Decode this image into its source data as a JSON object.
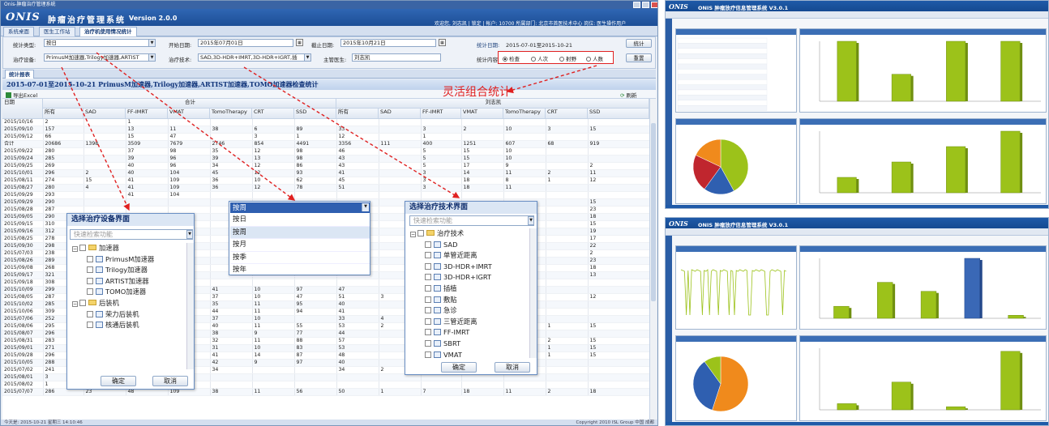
{
  "window": {
    "title": "Onis-肿瘤治疗管理系统"
  },
  "app": {
    "logo": "ONIS",
    "name": "肿瘤治疗管理系统",
    "version": "Version 2.0.0"
  },
  "user_bar": {
    "text": "欢迎您, 刘志凯 | 锁定 | 帐户: 10700 所属部门: 北京市首医技术中心 岗位: 医生操作用户"
  },
  "tabs": [
    {
      "label": "系统桌面"
    },
    {
      "label": "医生工作站"
    },
    {
      "label": "治疗机使用情况统计"
    }
  ],
  "filters": {
    "stat_type_label": "统计类型:",
    "stat_type_value": "按日",
    "start_label": "开始日期:",
    "start_value": "2015年07月01日",
    "end_label": "截止日期:",
    "end_value": "2015年10月21日",
    "stat_date_label": "统计日期:",
    "stat_date_value": "2015-07-01至2015-10-21",
    "device_label": "治疗设备:",
    "device_value": "PrimusM加速器,Trilogy加速器,ARTIST",
    "tech_label": "治疗技术:",
    "tech_value": "SAD,3D-HDR+IMRT,3D-HDR+IGRT,插",
    "doctor_label": "主管医生:",
    "doctor_value": "刘志凯",
    "content_label": "统计内容:",
    "radios": [
      {
        "label": "检查",
        "checked": true
      },
      {
        "label": "人次",
        "checked": false
      },
      {
        "label": "射野",
        "checked": false
      },
      {
        "label": "人数",
        "checked": false
      }
    ],
    "stat_button": "统计",
    "reset_button": "重置"
  },
  "report": {
    "tab": "统计报表",
    "title": "2015-07-01至2015-10-21 PrimusM加速器,Trilogy加速器,ARTIST加速器,TOMO加速器检查统计",
    "export": "导出Excel",
    "refresh": "刷新",
    "group1": "合计",
    "group2": "刘志凯",
    "date_col": "日期",
    "columns1": [
      "所有",
      "SAD",
      "FF-IMRT",
      "VMAT",
      "TomoTherapy",
      "CRT",
      "SSD"
    ],
    "columns2": [
      "所有",
      "SAD",
      "FF-IMRT",
      "VMAT",
      "TomoTherapy",
      "CRT",
      "SSD"
    ],
    "rows": [
      [
        "2015/10/16",
        "2",
        "",
        "1",
        "",
        "",
        "",
        "",
        "",
        "",
        "",
        "",
        "",
        "",
        ""
      ],
      [
        "2015/09/10",
        "157",
        "",
        "13",
        "11",
        "38",
        "6",
        "89",
        "33",
        "",
        "3",
        "2",
        "10",
        "3",
        "15"
      ],
      [
        "2015/09/12",
        "66",
        "",
        "15",
        "47",
        "",
        "3",
        "1",
        "12",
        "",
        "1",
        "",
        "",
        "",
        ""
      ],
      [
        "合计",
        "20686",
        "1398",
        "3509",
        "7679",
        "2746",
        "854",
        "4491",
        "3356",
        "111",
        "400",
        "1251",
        "607",
        "68",
        "919"
      ],
      [
        "2015/09/22",
        "280",
        "",
        "37",
        "98",
        "35",
        "12",
        "98",
        "46",
        "",
        "5",
        "15",
        "10",
        "",
        ""
      ],
      [
        "2015/09/24",
        "285",
        "",
        "39",
        "96",
        "39",
        "13",
        "98",
        "43",
        "",
        "5",
        "15",
        "10",
        "",
        ""
      ],
      [
        "2015/09/25",
        "269",
        "",
        "40",
        "96",
        "34",
        "12",
        "86",
        "43",
        "",
        "5",
        "17",
        "9",
        "",
        "2"
      ],
      [
        "2015/10/01",
        "296",
        "2",
        "40",
        "104",
        "45",
        "12",
        "93",
        "41",
        "",
        "3",
        "14",
        "11",
        "2",
        "11"
      ],
      [
        "2015/08/11",
        "274",
        "15",
        "41",
        "109",
        "36",
        "10",
        "62",
        "45",
        "",
        "3",
        "18",
        "8",
        "1",
        "12"
      ],
      [
        "2015/08/27",
        "280",
        "4",
        "41",
        "109",
        "36",
        "12",
        "78",
        "51",
        "",
        "3",
        "18",
        "11",
        "",
        ""
      ],
      [
        "2015/09/29",
        "293",
        "",
        "41",
        "104",
        "",
        "",
        "",
        "",
        "",
        "",
        "",
        "",
        "",
        ""
      ],
      [
        "2015/09/29",
        "290",
        "",
        "",
        "",
        "",
        "",
        "",
        "",
        "",
        "",
        "",
        "",
        "",
        "15"
      ],
      [
        "2015/08/28",
        "287",
        "",
        "",
        "",
        "",
        "",
        "",
        "",
        "",
        "",
        "",
        "",
        "",
        "23"
      ],
      [
        "2015/09/05",
        "290",
        "",
        "",
        "",
        "",
        "",
        "",
        "",
        "",
        "",
        "",
        "",
        "",
        "18"
      ],
      [
        "2015/09/15",
        "310",
        "",
        "",
        "",
        "",
        "",
        "",
        "",
        "",
        "",
        "",
        "",
        "",
        "15"
      ],
      [
        "2015/09/16",
        "312",
        "",
        "",
        "",
        "",
        "",
        "",
        "",
        "",
        "",
        "",
        "",
        "",
        "19"
      ],
      [
        "2015/08/25",
        "278",
        "",
        "",
        "",
        "",
        "",
        "",
        "",
        "",
        "",
        "",
        "",
        "",
        "17"
      ],
      [
        "2015/09/30",
        "298",
        "",
        "",
        "",
        "",
        "",
        "",
        "",
        "",
        "",
        "",
        "",
        "",
        "22"
      ],
      [
        "2015/07/03",
        "238",
        "",
        "",
        "",
        "",
        "",
        "",
        "",
        "",
        "",
        "",
        "",
        "",
        "2"
      ],
      [
        "2015/08/26",
        "289",
        "",
        "",
        "",
        "",
        "",
        "",
        "",
        "",
        "",
        "",
        "",
        "",
        "23"
      ],
      [
        "2015/09/08",
        "268",
        "",
        "",
        "",
        "",
        "",
        "",
        "",
        "",
        "",
        "",
        "",
        "",
        "18"
      ],
      [
        "2015/09/17",
        "321",
        "",
        "",
        "",
        "",
        "",
        "",
        "",
        "",
        "",
        "",
        "",
        "",
        "13"
      ],
      [
        "2015/09/18",
        "308",
        "",
        "",
        "",
        "",
        "",
        "",
        "",
        "",
        "",
        "",
        "",
        "",
        ""
      ],
      [
        "2015/10/09",
        "299",
        "",
        "",
        "",
        "41",
        "10",
        "97",
        "47",
        "",
        "",
        "",
        "",
        "",
        ""
      ],
      [
        "2015/08/05",
        "287",
        "",
        "",
        "",
        "37",
        "10",
        "47",
        "51",
        "3",
        "",
        "",
        "",
        "",
        "12"
      ],
      [
        "2015/10/02",
        "285",
        "",
        "",
        "",
        "35",
        "11",
        "95",
        "40",
        "",
        "",
        "",
        "",
        "",
        ""
      ],
      [
        "2015/10/06",
        "309",
        "",
        "",
        "",
        "44",
        "11",
        "94",
        "41",
        "",
        "",
        "",
        "",
        "",
        ""
      ],
      [
        "2015/07/06",
        "252",
        "",
        "",
        "",
        "37",
        "10",
        "",
        "33",
        "4",
        "",
        "",
        "",
        "",
        ""
      ],
      [
        "2015/08/06",
        "295",
        "",
        "",
        "",
        "40",
        "11",
        "55",
        "53",
        "2",
        "",
        "",
        "",
        "1",
        "15"
      ],
      [
        "2015/08/07",
        "296",
        "",
        "",
        "",
        "38",
        "9",
        "77",
        "44",
        "",
        "",
        "",
        "",
        "",
        ""
      ],
      [
        "2015/08/31",
        "283",
        "",
        "",
        "",
        "32",
        "11",
        "88",
        "57",
        "",
        "",
        "",
        "",
        "2",
        "15"
      ],
      [
        "2015/09/01",
        "271",
        "",
        "",
        "",
        "31",
        "10",
        "83",
        "53",
        "",
        "",
        "",
        "",
        "1",
        "15"
      ],
      [
        "2015/09/28",
        "296",
        "",
        "",
        "",
        "41",
        "14",
        "87",
        "48",
        "",
        "",
        "",
        "",
        "1",
        "15"
      ],
      [
        "2015/10/05",
        "288",
        "",
        "",
        "",
        "42",
        "9",
        "97",
        "40",
        "",
        "7",
        "12",
        "8",
        "",
        ""
      ],
      [
        "2015/07/02",
        "241",
        "42",
        "48",
        "104",
        "34",
        "",
        "",
        "34",
        "2",
        "7",
        "19",
        "5",
        "",
        ""
      ],
      [
        "2015/08/01",
        "3",
        "",
        "3",
        "",
        "",
        "",
        "",
        "",
        "",
        "",
        "",
        "",
        "",
        ""
      ],
      [
        "2015/08/02",
        "1",
        "",
        "1",
        "",
        "",
        "",
        "",
        "",
        "",
        "",
        "",
        "",
        "",
        ""
      ],
      [
        "2015/07/07",
        "286",
        "23",
        "48",
        "109",
        "38",
        "11",
        "56",
        "50",
        "1",
        "7",
        "18",
        "11",
        "2",
        "18"
      ]
    ]
  },
  "callout": {
    "text": "灵活组合统计"
  },
  "device_popup": {
    "title": "选择治疗设备界面",
    "search": "快速检索功能",
    "tree": [
      {
        "label": "加速器",
        "level": 0,
        "type": "folder"
      },
      {
        "label": "PrimusM加速器",
        "level": 1,
        "type": "leaf"
      },
      {
        "label": "Trilogy加速器",
        "level": 1,
        "type": "leaf"
      },
      {
        "label": "ARTIST加速器",
        "level": 1,
        "type": "leaf"
      },
      {
        "label": "TOMO加速器",
        "level": 1,
        "type": "leaf"
      },
      {
        "label": "后装机",
        "level": 0,
        "type": "folder"
      },
      {
        "label": "荣力后装机",
        "level": 1,
        "type": "leaf"
      },
      {
        "label": "核通后装机",
        "level": 1,
        "type": "leaf"
      }
    ],
    "ok": "确定",
    "cancel": "取消"
  },
  "period_popup": {
    "selected": "按周",
    "options": [
      "按日",
      "按周",
      "按月",
      "按季",
      "按年"
    ]
  },
  "tech_popup": {
    "title": "选择治疗技术界面",
    "search": "快速检索功能",
    "tree": [
      {
        "label": "治疗技术",
        "level": 0,
        "type": "folder"
      },
      {
        "label": "SAD",
        "level": 1,
        "type": "leaf"
      },
      {
        "label": "单管近距离",
        "level": 1,
        "type": "leaf"
      },
      {
        "label": "3D-HDR+IMRT",
        "level": 1,
        "type": "leaf"
      },
      {
        "label": "3D-HDR+IGRT",
        "level": 1,
        "type": "leaf"
      },
      {
        "label": "插植",
        "level": 1,
        "type": "leaf"
      },
      {
        "label": "敷贴",
        "level": 1,
        "type": "leaf"
      },
      {
        "label": "急诊",
        "level": 1,
        "type": "leaf"
      },
      {
        "label": "三管近距离",
        "level": 1,
        "type": "leaf"
      },
      {
        "label": "FF-IMRT",
        "level": 1,
        "type": "leaf"
      },
      {
        "label": "SBRT",
        "level": 1,
        "type": "leaf"
      },
      {
        "label": "VMAT",
        "level": 1,
        "type": "leaf"
      }
    ],
    "ok": "确定",
    "cancel": "取消"
  },
  "status": {
    "left": "今天是: 2015-10-21 星期三 14:10:46",
    "right": "Copyright 2010 ISL Group 中国 成都"
  },
  "right_screens": [
    {
      "title": "ONIS 肿瘤放疗信息管理系统 V3.0.1",
      "bars": [
        100,
        45,
        100,
        100
      ],
      "bars2": [
        25,
        50,
        75,
        100
      ],
      "pie": [
        0.42,
        0.18,
        0.22,
        0.18
      ]
    },
    {
      "title": "ONIS 肿瘤放疗信息管理系统 V3.0.1",
      "bars": [
        20,
        60,
        45,
        100,
        5
      ],
      "bars2": [
        10,
        45,
        5,
        95
      ],
      "pie": [
        0.55,
        0.35,
        0.1
      ]
    }
  ],
  "colors": {
    "accent": "#e02020",
    "header": "#1d4e96",
    "bar": "#9cc21a",
    "highlight": "#2f5fb0"
  }
}
